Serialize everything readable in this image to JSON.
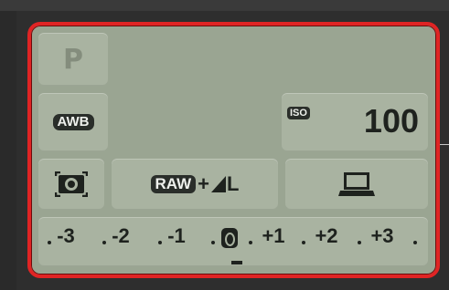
{
  "camera_settings": {
    "shooting_mode": "P",
    "white_balance": "AWB",
    "iso": {
      "badge": "ISO",
      "value": "100"
    },
    "metering": {
      "icon": "evaluative-metering-icon"
    },
    "image_quality": {
      "raw": "RAW",
      "plus": "+",
      "jpeg_size": "L",
      "icon": "fine-jpeg-quality-icon"
    },
    "save_destination": {
      "icon": "computer-laptop-icon"
    },
    "exposure_compensation": {
      "scale": [
        "-3",
        "-2",
        "-1",
        "0",
        "+1",
        "+2",
        "+3"
      ],
      "current_value": 0
    }
  },
  "colors": {
    "lcd_background": "#9aa592",
    "cell_background": "#a9b3a1",
    "selection_border": "#e02424",
    "text_dark": "#1e221e",
    "mode_text_dim": "#848d7d"
  }
}
